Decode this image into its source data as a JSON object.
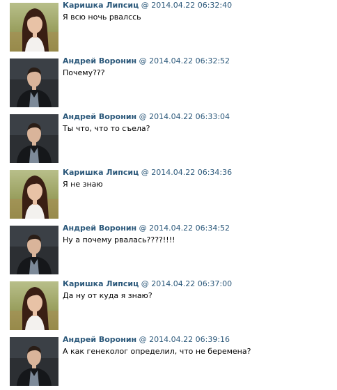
{
  "messages": [
    {
      "author": "Каришка Липсиц",
      "separator": "@",
      "timestamp": "2014.04.22 06:32:40",
      "text": "Я всю ночь рвалссь",
      "avatar": "girl"
    },
    {
      "author": "Андрей Воронин",
      "separator": "@",
      "timestamp": "2014.04.22 06:32:52",
      "text": "Почему???",
      "avatar": "boy"
    },
    {
      "author": "Андрей Воронин",
      "separator": "@",
      "timestamp": "2014.04.22 06:33:04",
      "text": "Ты что, что то съела?",
      "avatar": "boy"
    },
    {
      "author": "Каришка Липсиц",
      "separator": "@",
      "timestamp": "2014.04.22 06:34:36",
      "text": "Я не знаю",
      "avatar": "girl"
    },
    {
      "author": "Андрей Воронин",
      "separator": "@",
      "timestamp": "2014.04.22 06:34:52",
      "text": "Ну а почему рвалась????!!!!",
      "avatar": "boy"
    },
    {
      "author": "Каришка Липсиц",
      "separator": "@",
      "timestamp": "2014.04.22 06:37:00",
      "text": "Да ну от куда я знаю?",
      "avatar": "girl"
    },
    {
      "author": "Андрей Воронин",
      "separator": "@",
      "timestamp": "2014.04.22 06:39:16",
      "text": "А как генеколог определил, что не беремена?",
      "avatar": "boy"
    }
  ]
}
